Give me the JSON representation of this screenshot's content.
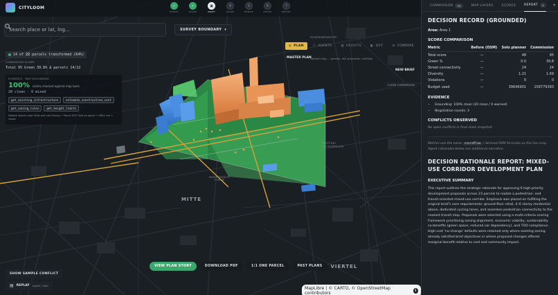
{
  "app": {
    "name": "CITYLOOM"
  },
  "steps": [
    {
      "label": "SURVEY",
      "mark": "✓",
      "state": "done"
    },
    {
      "label": "INTAKE",
      "mark": "✓",
      "state": "done"
    },
    {
      "label": "DRAFT",
      "mark": "▣",
      "state": "active"
    },
    {
      "label": "SCORE",
      "mark": "4",
      "state": "todo"
    },
    {
      "label": "DEBATE",
      "mark": "5",
      "state": "todo"
    },
    {
      "label": "REVISE",
      "mark": "6",
      "state": "todo"
    },
    {
      "label": "REPORT",
      "mark": "7",
      "state": "todo"
    }
  ],
  "search": {
    "placeholder": "Search place or lat, lng..."
  },
  "survey_boundary": {
    "label": "SURVEY BOUNDARY"
  },
  "parcels_panel": {
    "summary_prefix": "14 of",
    "summary_total": "22",
    "summary_suffix": "parcels transformed (64%)",
    "commission_slider": "COMMISSION SLIDER",
    "totals": "Total 95  Green 39.8%  Δ parcels 14/22"
  },
  "evidence": {
    "title": "EVIDENCE · MAP GROUNDING",
    "percent": "100%",
    "claims": "claims checked against map tools",
    "clean": "20 clean · 0 mixed",
    "tools": [
      "get_existing_infrastructure",
      "estimate_construction_cost",
      "get_zoning_rules",
      "get_height_limits"
    ],
    "note": "Debate agents load Skills and call Zoning + Parcel MCP. Add an agent → SKILL.md + roster."
  },
  "map_tools": {
    "schedule_label": "SCHEMAMENSESTE",
    "plan": "PLAN",
    "agents": "AGENTS",
    "heights": "HEIGHTS",
    "diff": "DIFF",
    "compare": "COMPARE",
    "close": "×",
    "master_plan": "MASTER PLAN",
    "master_plan_desc": "Default map — parcels, live proposals, conflicts",
    "new_brief": "NEW BRIEF",
    "clear_commission": "CLEAR COMMISSION"
  },
  "map_labels": {
    "mitte": "MITTE",
    "viertel": "VIERTEL",
    "fernsehturm": "Berliner Fernsehturm",
    "park": "MARX ENGELS FORUM"
  },
  "bottom_actions": {
    "view_plan_story": "VIEW PLAN STORY",
    "download_pdf": "DOWNLOAD PDF",
    "one_parcel": "1/1 ONE PARCEL",
    "past_plans": "PAST PLANS"
  },
  "show_sample_conflict": "SHOW SAMPLE CONFLICT",
  "replay": {
    "label": "REPLAY",
    "sub": "export / load"
  },
  "attribution": "MapLibre | © CARTO, © OpenStreetMap contributors",
  "panel": {
    "tabs": [
      {
        "label": "COMMISSION",
        "count": "30"
      },
      {
        "label": "MAP LAYERS",
        "count": ""
      },
      {
        "label": "SCORES",
        "count": ""
      },
      {
        "label": "REPORT",
        "count": "4"
      }
    ],
    "title": "DECISION RECORD (GROUNDED)",
    "area_label": "Area:",
    "area_value": "Area 1",
    "score_heading": "SCORE COMPARISON",
    "score_cols": [
      "Metric",
      "Before (OSM)",
      "Solo planner",
      "Commission"
    ],
    "score_rows": [
      [
        "Total score",
        "—",
        "48",
        "95"
      ],
      [
        "Green %",
        "—",
        "0.0",
        "39.8"
      ],
      [
        "Street connectivity",
        "—",
        "24",
        "24"
      ],
      [
        "Diversity",
        "—",
        "1.21",
        "1.69"
      ],
      [
        "Violations",
        "—",
        "0",
        "0"
      ],
      [
        "Budget used",
        "—",
        "39646901",
        "158779393"
      ]
    ],
    "evidence_heading": "EVIDENCE",
    "evidence_items": [
      "Grounding: 100% clean (20 clean / 0 warned)",
      "Negotiation rounds: 3"
    ],
    "conflicts_heading": "CONFLICTS OBSERVED",
    "conflicts_text": "No open conflicts in final state snapshot.",
    "metrics_pre": "Metrics use the same",
    "metrics_code": "scorePlan",
    "metrics_post": "/ derived OSM formulas as the live map. Agent rationales below are additional narrative.",
    "report_title": "DECISION RATIONALE REPORT: MIXED-USE CORRIDOR DEVELOPMENT PLAN",
    "exec_heading": "EXECUTIVE SUMMARY",
    "exec_text": "This report outlines the strategic rationale for approving 6 high-priority development proposals across 23 parcels to realize a pedestrian- and transit-oriented mixed-use corridor. Emphasis was placed on fulfilling the original brief's core requirements: ground-floor retail, 4–6 storey residential above, dedicated cycling lanes, and seamless pedestrian connectivity to the nearest transit stop. Proposals were selected using a multi-criteria scoring framework prioritizing zoning alignment, economic viability, sustainability co-benefits (green space, reduced car dependency), and TOD compliance. High-cost 'no-change' defaults were retained only where existing zoning already satisfied brief objectives or where proposed changes offered marginal benefit relative to cost and community impact."
  }
}
